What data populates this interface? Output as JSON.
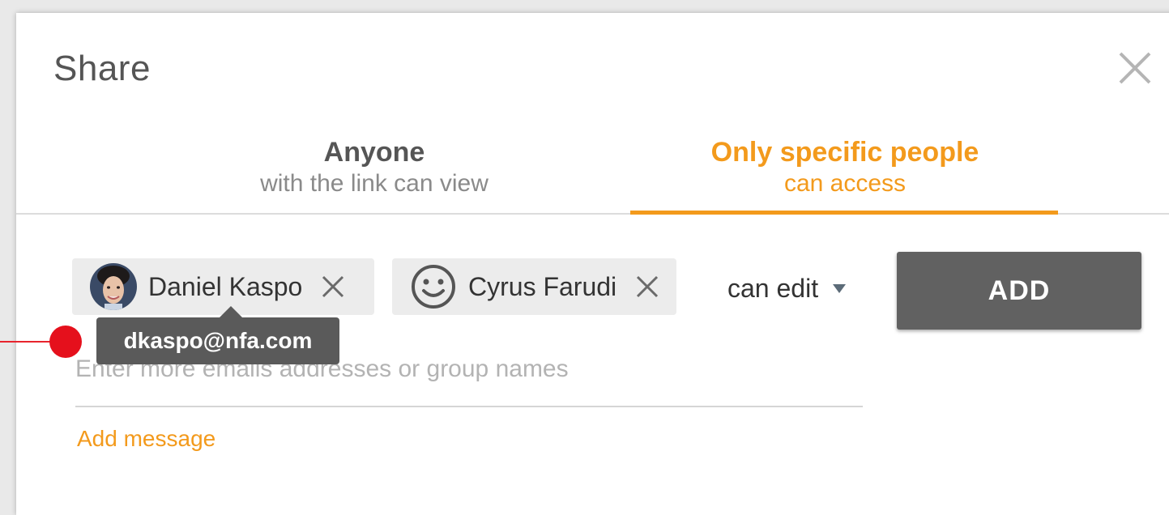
{
  "dialog": {
    "title": "Share"
  },
  "tabs": [
    {
      "title": "Anyone",
      "subtitle": "with the link can view"
    },
    {
      "title": "Only specific people",
      "subtitle": "can access"
    }
  ],
  "recipients": [
    {
      "name": "Daniel Kaspo",
      "avatar": "photo-avatar"
    },
    {
      "name": "Cyrus Farudi",
      "avatar": "smiley-face-icon"
    }
  ],
  "tooltip": {
    "text": "dkaspo@nfa.com"
  },
  "permission": {
    "selected": "can edit"
  },
  "add_button": {
    "label": "ADD"
  },
  "email_input": {
    "placeholder": "Enter more emails addresses or group names",
    "value": ""
  },
  "add_message": {
    "label": "Add message"
  },
  "colors": {
    "accent": "#f39a1c",
    "button": "#616161",
    "pointer": "#e5101c"
  }
}
